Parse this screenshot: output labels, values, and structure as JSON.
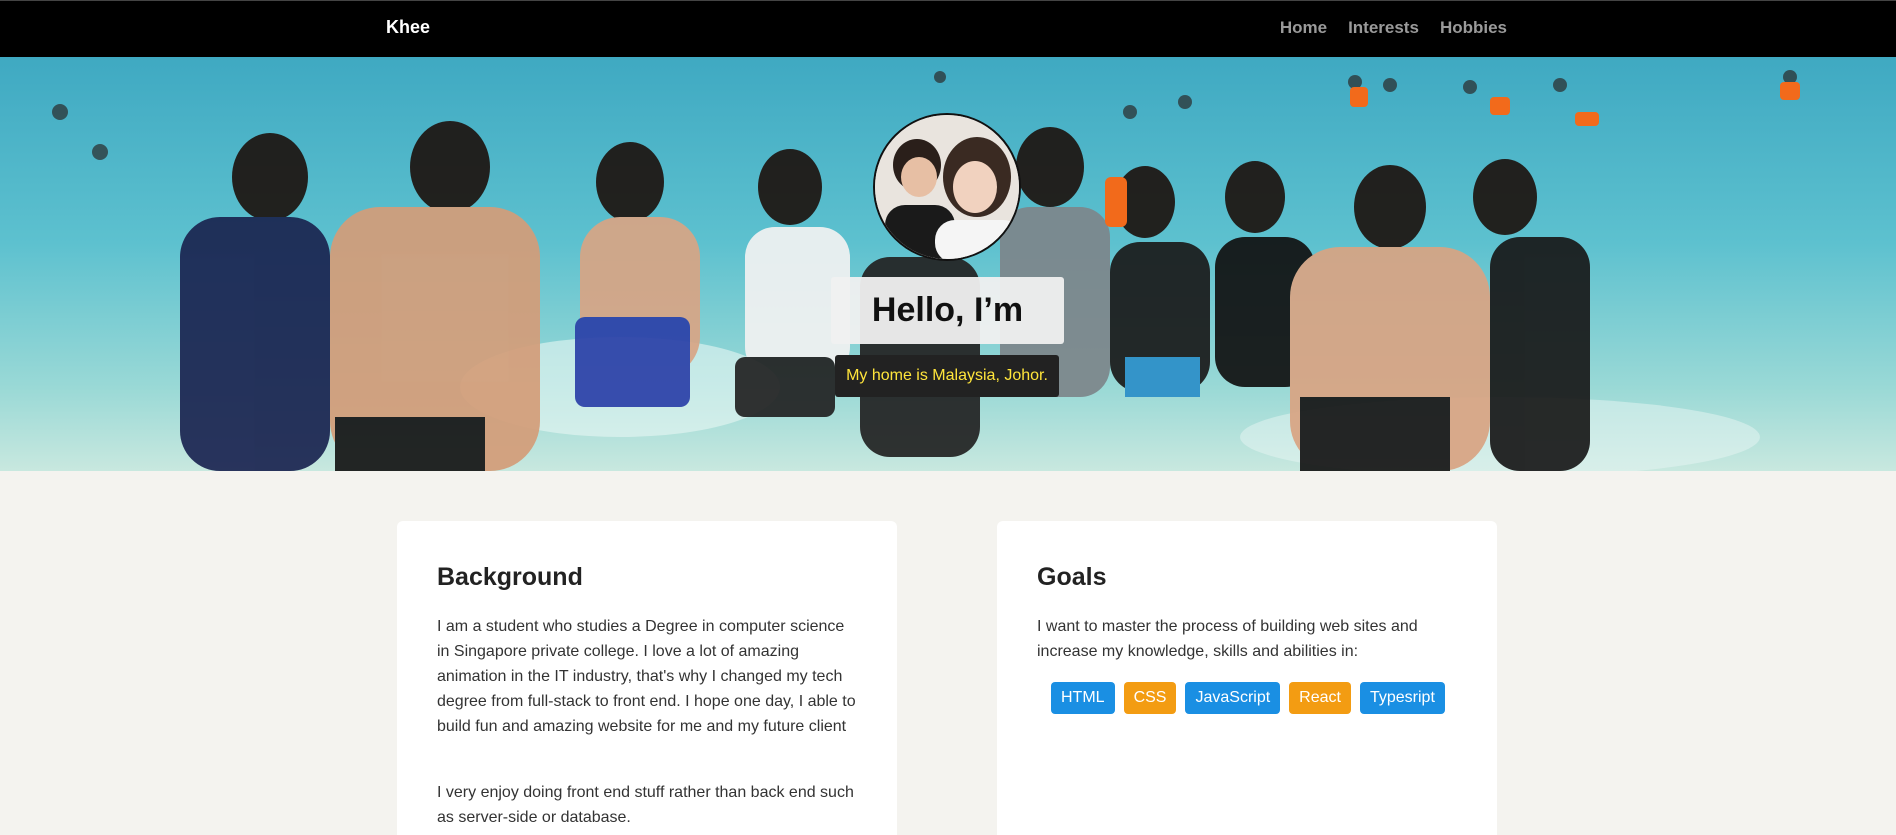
{
  "nav": {
    "brand": "Khee",
    "links": [
      "Home",
      "Interests",
      "Hobbies"
    ]
  },
  "hero": {
    "title": "Hello, I’m Khee",
    "subtitle": "My home is Malaysia, Johor."
  },
  "background": {
    "heading": "Background",
    "paragraphs": [
      "I am a student who studies a Degree in computer science in Singapore private college. I love a lot of amazing animation in the IT industry, that's why I changed my tech degree from full-stack to front end. I hope one day, I able to build fun and amazing website for me and my future client",
      "I very enjoy doing front end stuff rather than back end such as server-side or database."
    ]
  },
  "goals": {
    "heading": "Goals",
    "intro": "I want to master the process of building web sites and increase my knowledge, skills and abilities in:",
    "tags": [
      {
        "label": "HTML",
        "color": "#1a8fe3"
      },
      {
        "label": "CSS",
        "color": "#f39c12"
      },
      {
        "label": "JavaScript",
        "color": "#1a8fe3"
      },
      {
        "label": "React",
        "color": "#f39c12"
      },
      {
        "label": "Typesript",
        "color": "#1a8fe3"
      }
    ]
  },
  "colors": {
    "navbar": "#000000",
    "page_bg": "#f4f3ef",
    "subtitle_text": "#ffe53b"
  }
}
